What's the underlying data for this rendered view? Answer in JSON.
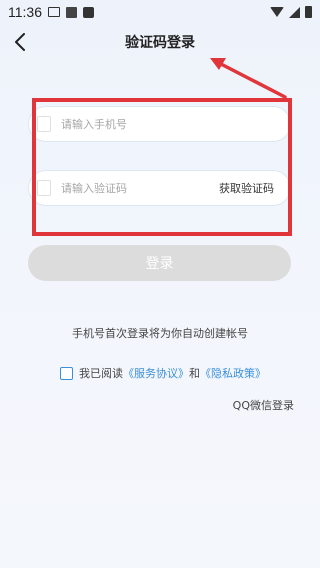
{
  "status_bar": {
    "time": "11:36"
  },
  "header": {
    "title": "验证码登录",
    "back_icon": "chevron-left-icon"
  },
  "phone_field": {
    "placeholder": "请输入手机号",
    "value": "",
    "icon": "phone-icon"
  },
  "code_field": {
    "placeholder": "请输入验证码",
    "value": "",
    "icon": "verification-icon",
    "get_code_label": "获取验证码"
  },
  "login_button": {
    "label": "登录"
  },
  "hint_text": "手机号首次登录将为你自动创建帐号",
  "agreement": {
    "prefix": "我已阅读",
    "service_link": "《服务协议》",
    "connector": "和",
    "privacy_link": "《隐私政策》",
    "checked": false
  },
  "alt_login": {
    "label": "QQ微信登录"
  },
  "colors": {
    "accent": "#3b8fd9",
    "highlight": "#e0363b",
    "button_disabled": "#dcdcdc"
  }
}
